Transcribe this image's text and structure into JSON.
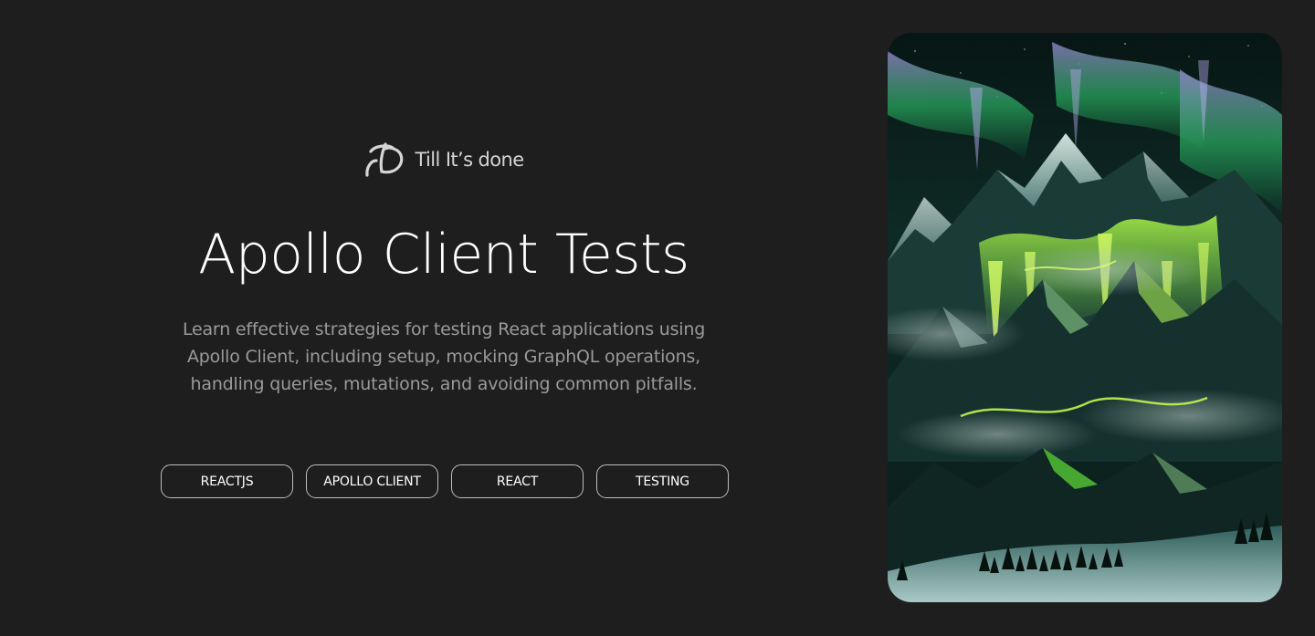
{
  "brand": {
    "name": "Till It’s done",
    "logo_icon": "td-monogram-logo"
  },
  "article": {
    "title": "Apollo Client Tests",
    "description": "Learn effective strategies for testing React applications using Apollo Client, including setup, mocking GraphQL operations, handling queries, mutations, and avoiding common pitfalls.",
    "tags": [
      "REACTJS",
      "APOLLO CLIENT",
      "REACT",
      "TESTING"
    ]
  },
  "cover_image": {
    "subject": "aurora-mountains-illustration",
    "colors": {
      "sky": "#0b1f1d",
      "aurora_green": "#7bff3a",
      "aurora_teal": "#1f8a5a",
      "aurora_violet": "#9b8ad6",
      "snow": "#d9ece8"
    }
  },
  "theme": {
    "background": "#1e1e1e",
    "title_color": "#ffffff",
    "text_muted": "#9a9a9a",
    "tag_border": "#bdbdbd"
  }
}
